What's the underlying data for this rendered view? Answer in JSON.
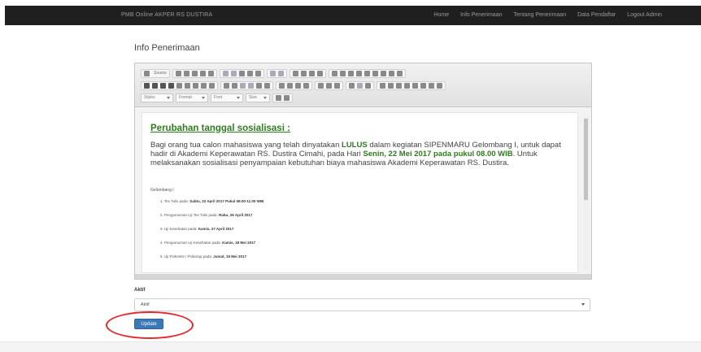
{
  "navbar": {
    "brand": "PMB Online AKPER RS DUSTIRA",
    "links": [
      "Home",
      "Info Penerimaan",
      "Tentang Penerimaan",
      "Data Pendaftar",
      "Logout Admin"
    ]
  },
  "page": {
    "title": "Info Penerimaan"
  },
  "editor": {
    "toolbar": {
      "source_label": "Source",
      "styles_label": "Styles",
      "format_label": "Format",
      "font_label": "Font",
      "size_label": "Size"
    },
    "content": {
      "heading": "Perubahan tanggal sosialisasi :",
      "para_1": "Bagi orang tua calon mahasiswa yang telah dinyatakan",
      "lulus": "LULUS",
      "para_2": "dalam kegiatan SIPENMARU Gelombang I, untuk dapat hadir di Akademi Keperawatan RS. Dustira Cimahi, pada Hari",
      "date": "Senin, 22 Mei 2017 pada pukul 08.00 WIB",
      "para_3": ". Untuk melaksanakan sosialisasi penyampaian kebutuhan biaya mahasiswa Akademi Keperawatan RS. Dustira.",
      "subheading": "Gelombang I",
      "list": [
        {
          "text": "1. Tes Tulis pada:",
          "strong": "Sabtu, 22 April 2017 Pukul 08.00-11.00 WIB"
        },
        {
          "text": "2. Pengumuman Uji Tes Tulis pada:",
          "strong": "Rabu, 26 April 2017"
        },
        {
          "text": "3. Uji Kesehatan pada:",
          "strong": "Kamis, 27 April 2017"
        },
        {
          "text": "4. Pengumuman Uji Kesehatan pada:",
          "strong": "Kamis, 18 Mei 2017"
        },
        {
          "text": "5. Uji Psikotest / Psikologi pada:",
          "strong": "Jumat, 19 Mei 2017"
        }
      ]
    }
  },
  "form": {
    "aktif_label": "Aktif",
    "aktif_value": "Aktif"
  },
  "actions": {
    "update_label": "Update"
  },
  "colors": {
    "accent": "#3a78b8",
    "highlight": "#e32a2a",
    "green_text": "#2e7d1e"
  }
}
